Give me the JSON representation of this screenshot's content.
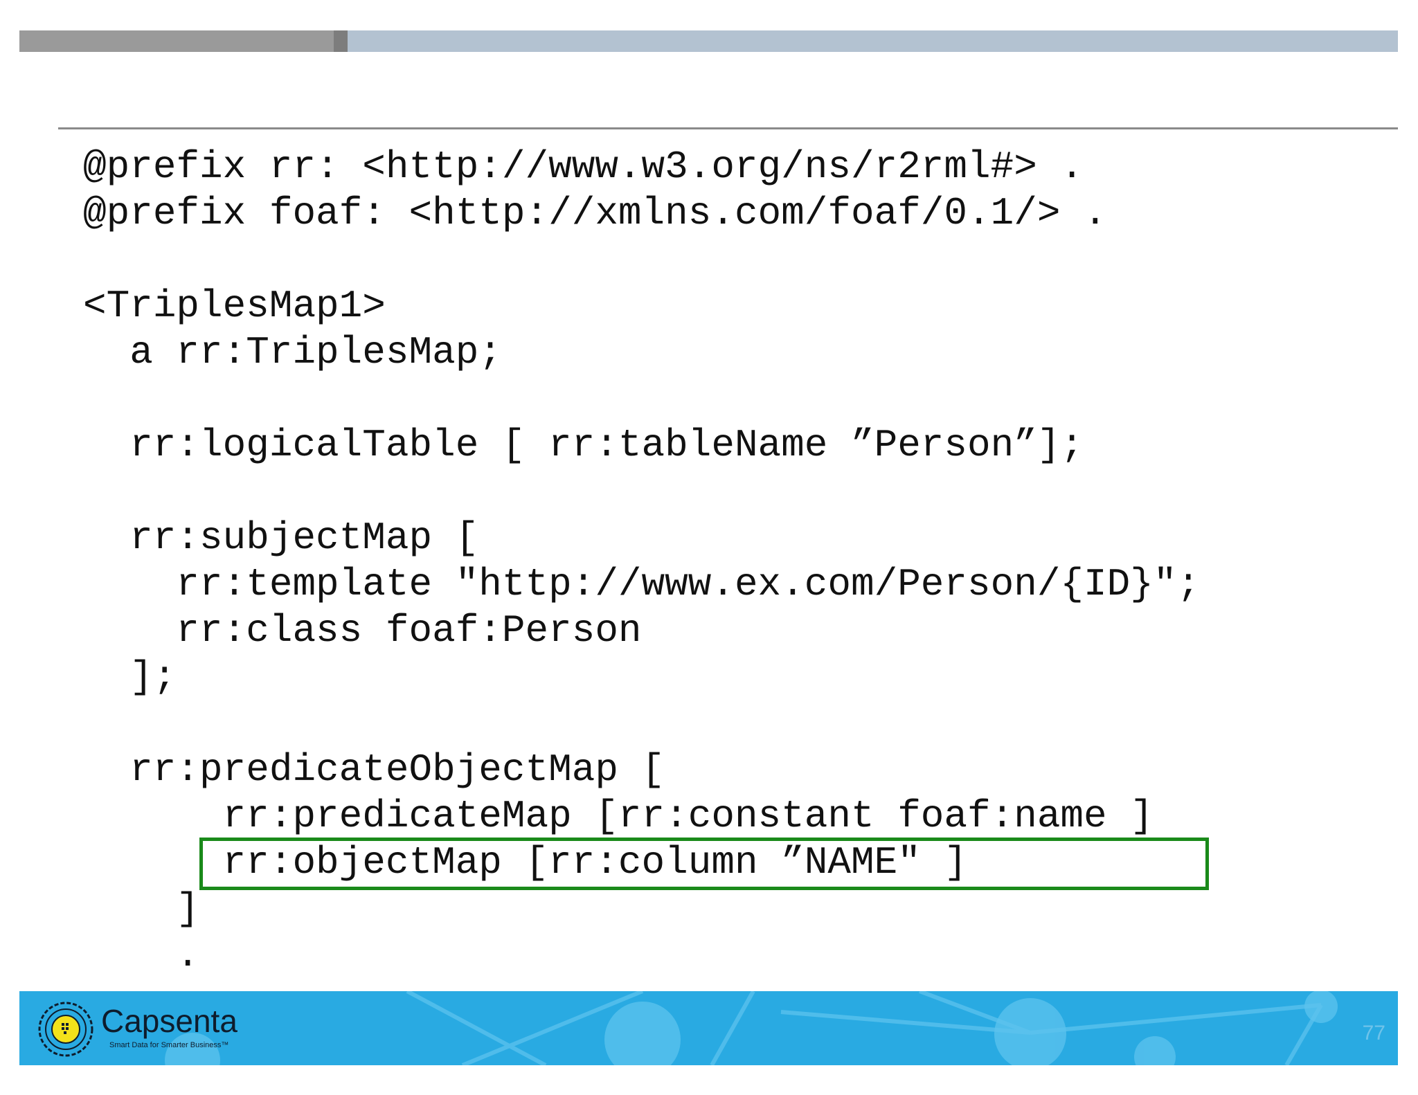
{
  "code_lines": [
    "@prefix rr: <http://www.w3.org/ns/r2rml#> .",
    "@prefix foaf: <http://xmlns.com/foaf/0.1/> .",
    "",
    "<TriplesMap1>",
    "  a rr:TriplesMap;",
    "",
    "  rr:logicalTable [ rr:tableName ”Person”];",
    "",
    "  rr:subjectMap [",
    "    rr:template \"http://www.ex.com/Person/{ID}\";",
    "    rr:class foaf:Person",
    "  ];",
    "",
    "  rr:predicateObjectMap [",
    "      rr:predicateMap [rr:constant foaf:name ]",
    "      rr:objectMap [rr:column ”NAME\" ]",
    "    ]",
    "    ."
  ],
  "footer": {
    "brand": "Capsenta",
    "tagline": "Smart Data for Smarter Business™",
    "page_number": "77"
  },
  "colors": {
    "highlight_border": "#1a8a1a",
    "footer_bg": "#29aae2",
    "topbar_dark": "#9a9a9a",
    "topbar_light": "#b3c2d1"
  }
}
